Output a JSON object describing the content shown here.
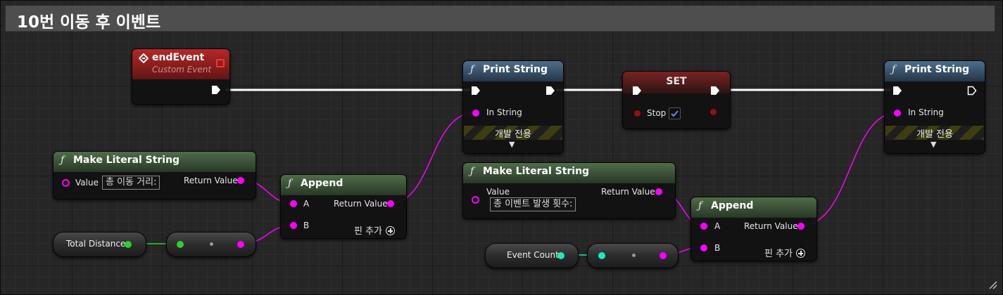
{
  "comment": {
    "title": "10번 이동 후 이벤트"
  },
  "nodes": {
    "end_event": {
      "title": "endEvent",
      "subtitle": "Custom Event"
    },
    "make_literal_1": {
      "title": "Make Literal String",
      "value_label": "Value",
      "value": "총 이동 거리:",
      "return_label": "Return Value"
    },
    "append_1": {
      "title": "Append",
      "pin_a": "A",
      "pin_b": "B",
      "return_label": "Return Value",
      "add_pin": "핀 추가"
    },
    "total_distance": {
      "label": "Total Distance"
    },
    "print_string_1": {
      "title": "Print String",
      "in_string": "In String",
      "dev_only": "개발 전용"
    },
    "set_node": {
      "title": "SET",
      "stop_label": "Stop",
      "stop_checked": true
    },
    "make_literal_2": {
      "title": "Make Literal String",
      "value_label": "Value",
      "value": "총 이벤트 발생 횟수:",
      "return_label": "Return Value"
    },
    "append_2": {
      "title": "Append",
      "pin_a": "A",
      "pin_b": "B",
      "return_label": "Return Value",
      "add_pin": "핀 추가"
    },
    "event_count": {
      "label": "Event Count"
    },
    "print_string_2": {
      "title": "Print String",
      "in_string": "In String",
      "dev_only": "개발 전용"
    }
  },
  "colors": {
    "exec_wire": "#ffffff",
    "string_wire": "#ff00ff",
    "float_wire": "#2ad12a",
    "int_wire": "#1de9c0",
    "bool_pin": "#9c0c0c",
    "function_header": "#4f6c48",
    "print_header": "#4e6e8d",
    "event_header": "#b52828"
  },
  "icons": {
    "function": "function-f-icon",
    "event": "event-diamond-icon",
    "exec": "exec-arrow-icon",
    "add": "add-circle-icon",
    "expand": "chevron-down-icon",
    "check": "checkmark-icon",
    "resize": "resize-grip-icon"
  }
}
